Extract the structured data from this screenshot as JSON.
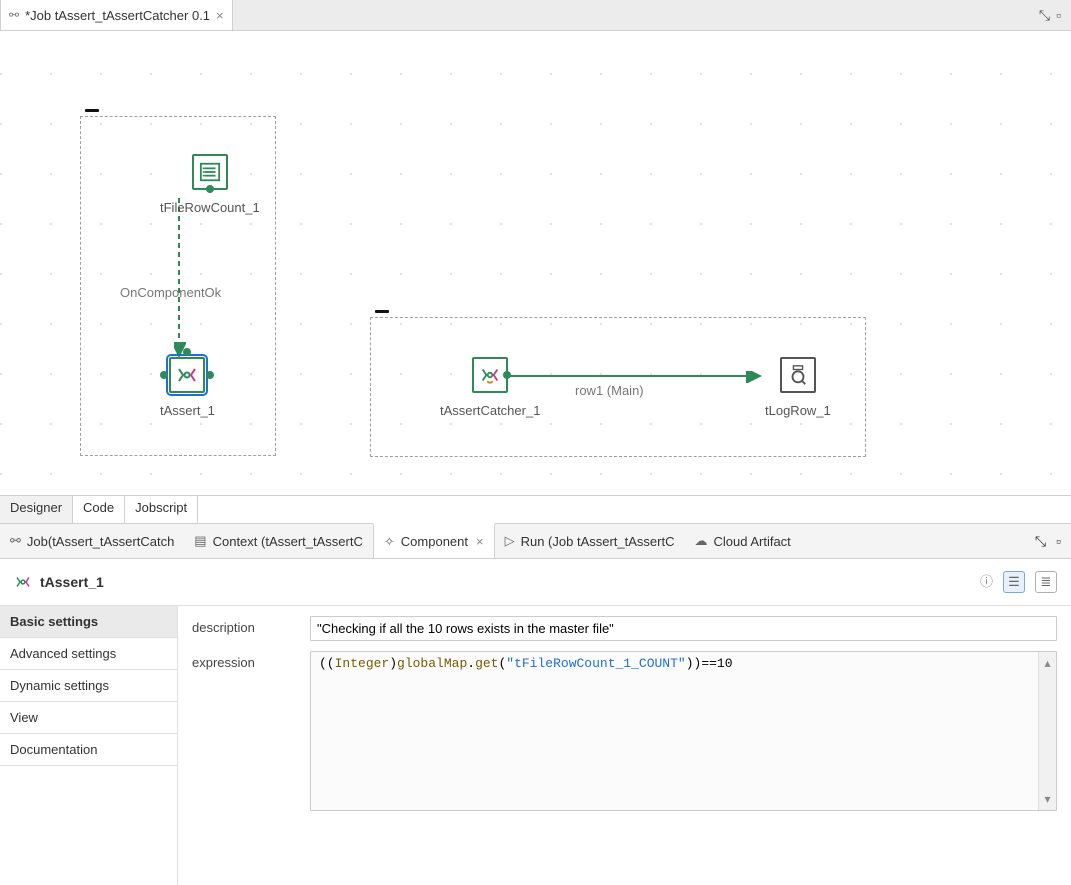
{
  "colors": {
    "green": "#2e8b57",
    "brown": "#7a5a00",
    "blue": "#1e6fd6"
  },
  "top_tab": {
    "title": "*Job tAssert_tAssertCatcher 0.1"
  },
  "canvas": {
    "components": {
      "tFileRowCount": "tFileRowCount_1",
      "tAssert": "tAssert_1",
      "tAssertCatcher": "tAssertCatcher_1",
      "tLogRow": "tLogRow_1"
    },
    "links": {
      "onCompOk": "OnComponentOk",
      "row1": "row1 (Main)"
    }
  },
  "mid_tabs": [
    "Designer",
    "Code",
    "Jobscript"
  ],
  "views": {
    "job": "Job(tAssert_tAssertCatch",
    "context": "Context (tAssert_tAssertC",
    "component": "Component",
    "run": "Run (Job tAssert_tAssertC",
    "cloud": "Cloud Artifact"
  },
  "component_panel": {
    "title": "tAssert_1",
    "side_tabs": [
      "Basic settings",
      "Advanced settings",
      "Dynamic settings",
      "View",
      "Documentation"
    ],
    "fields": {
      "description_label": "description",
      "description_value": "\"Checking if all the 10 rows exists in the master file\"",
      "expression_label": "expression",
      "expression_parts": {
        "p1": "((",
        "p2": "Integer",
        "p3": ")",
        "p4": "globalMap",
        "p5": ".",
        "p6": "get",
        "p7": "(",
        "p8": "\"tFileRowCount_1_COUNT\"",
        "p9": "))==10"
      }
    }
  }
}
